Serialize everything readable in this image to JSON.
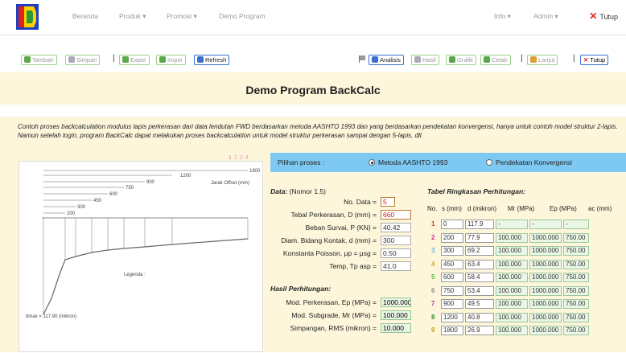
{
  "nav": {
    "items": [
      "Beranda",
      "Produk ▾",
      "Promosi ▾",
      "Demo Program"
    ],
    "right_items": [
      "Info ▾",
      "Admin ▾"
    ],
    "close": "Tutup"
  },
  "toolbar": {
    "tambah": "Tambah",
    "simpan": "Simpan",
    "expor": "Expor",
    "impor": "Impor",
    "refresh": "Refresh",
    "analisis": "Analisis",
    "hasil": "Hasil",
    "grafik": "Grafik",
    "cetak": "Cetak",
    "lanjut": "Lanjut",
    "tutup": "Tutup"
  },
  "page_title": "Demo Program BackCalc",
  "description": "Contoh proses backcalculation modulus lapis perkerasan dari data lendutan FWD berdasarkan metoda AASHTO 1993 dan yang berdasarkan pendekatan konvergensi, hanya untuk contoh model struktur 2-lapis. Namun setelah login, program BackCalc dapat melakukan proses backcalculation untuk model struktur perkerasan sampai dengan 5-lapis, dll.",
  "pager": [
    "1",
    "2",
    "3",
    "4"
  ],
  "chart": {
    "offsets": [
      "1800",
      "1200",
      "900",
      "750",
      "600",
      "450",
      "300",
      "200"
    ],
    "offset_label": "Jarak Offset (mm)",
    "legend_label": "Legenda :",
    "dmax_label": "dmax = 117.90 (mikron)"
  },
  "proses": {
    "label": "Pilihan proses :",
    "option1": "Metoda AASHTO 1993",
    "option2": "Pendekatan Konvergensi"
  },
  "data": {
    "heading": "Data:",
    "note": "(Nomor 1.5)",
    "fields": [
      {
        "label": "No. Data =",
        "value": "5"
      },
      {
        "label": "Tebal Perkerasan, D (mm) =",
        "value": "660"
      },
      {
        "label": "Beban Survai, P (KN) =",
        "value": "40.42"
      },
      {
        "label": "Diam. Bidang Kontak, d (mm) =",
        "value": "300"
      },
      {
        "label": "Konstanta Poisson, μp = μsg =",
        "value": "0.50"
      },
      {
        "label": "Temp, Tp asp =",
        "value": "41.0"
      }
    ]
  },
  "hasil": {
    "heading": "Hasil Perhitungan:",
    "fields": [
      {
        "label": "Mod. Perkerasan, Ep (MPa) =",
        "value": "1000.000"
      },
      {
        "label": "Mod. Subgrade, Mr (MPa) =",
        "value": "100.000"
      },
      {
        "label": "Simpangan, RMS (mikron) =",
        "value": "10.000"
      }
    ]
  },
  "tabel": {
    "heading": "Tabel Ringkasan Perhitungan:",
    "headers": [
      "No.",
      "s (mm)",
      "d (mikron)",
      "Mr (MPa)",
      "Ep (MPa)",
      "ac (mm)"
    ],
    "rows": [
      {
        "no": "1",
        "s": "0",
        "d": "117.9",
        "mr": "-",
        "ep": "-",
        "ac": "-"
      },
      {
        "no": "2",
        "s": "200",
        "d": "77.9",
        "mr": "100.000",
        "ep": "1000.000",
        "ac": "750.00"
      },
      {
        "no": "3",
        "s": "300",
        "d": "69.2",
        "mr": "100.000",
        "ep": "1000.000",
        "ac": "750.00"
      },
      {
        "no": "4",
        "s": "450",
        "d": "63.4",
        "mr": "100.000",
        "ep": "1000.000",
        "ac": "750.00"
      },
      {
        "no": "5",
        "s": "600",
        "d": "58.4",
        "mr": "100.000",
        "ep": "1000.000",
        "ac": "750.00"
      },
      {
        "no": "6",
        "s": "750",
        "d": "53.4",
        "mr": "100.000",
        "ep": "1000.000",
        "ac": "750.00"
      },
      {
        "no": "7",
        "s": "900",
        "d": "49.5",
        "mr": "100.000",
        "ep": "1000.000",
        "ac": "750.00"
      },
      {
        "no": "8",
        "s": "1200",
        "d": "40.8",
        "mr": "100.000",
        "ep": "1000.000",
        "ac": "750.00"
      },
      {
        "no": "9",
        "s": "1800",
        "d": "26.9",
        "mr": "100.000",
        "ep": "1000.000",
        "ac": "750.00"
      }
    ],
    "row_colors": [
      "#cc3333",
      "#d0309a",
      "#66b6e0",
      "#e0a030",
      "#58c040",
      "#909090",
      "#c0308a",
      "#3a8a3a",
      "#c0a020"
    ]
  }
}
